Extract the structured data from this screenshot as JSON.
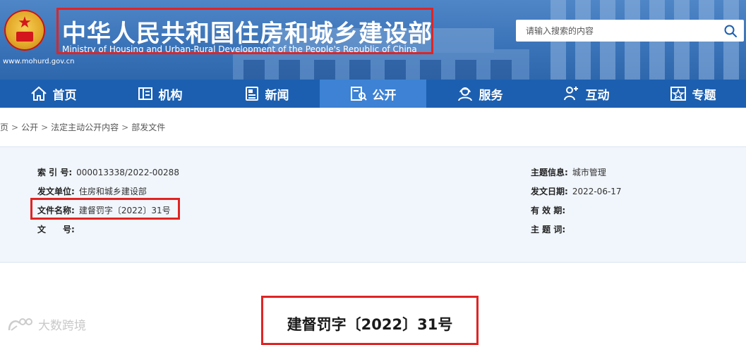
{
  "header": {
    "title_cn": "中华人民共和国住房和城乡建设部",
    "title_en": "Ministry of Housing and Urban-Rural Development of the People's Republic of China",
    "site_url": "www.mohurd.gov.cn",
    "search_placeholder": "请输入搜索的内容"
  },
  "nav": {
    "items": [
      {
        "label": "首页",
        "icon": "home-icon"
      },
      {
        "label": "机构",
        "icon": "org-icon"
      },
      {
        "label": "新闻",
        "icon": "news-icon"
      },
      {
        "label": "公开",
        "icon": "disclosure-icon",
        "active": true
      },
      {
        "label": "服务",
        "icon": "service-icon"
      },
      {
        "label": "互动",
        "icon": "interact-icon"
      },
      {
        "label": "专题",
        "icon": "topic-icon"
      }
    ]
  },
  "breadcrumb": [
    "页",
    "公开",
    "法定主动公开内容",
    "部发文件"
  ],
  "info": {
    "index_no_label": "索 引 号:",
    "index_no": "000013338/2022-00288",
    "issuer_label": "发文单位:",
    "issuer": "住房和城乡建设部",
    "doc_name_label": "文件名称:",
    "doc_name": "建督罚字〔2022〕31号",
    "doc_no_label": "文　　号:",
    "doc_no": "",
    "topic_label": "主题信息:",
    "topic": "城市管理",
    "date_label": "发文日期:",
    "date": "2022-06-17",
    "validity_label": "有 效 期:",
    "validity": "",
    "keywords_label": "主 题 词:",
    "keywords": ""
  },
  "doc_title": "建督罚字〔2022〕31号",
  "watermark": "大数跨境",
  "colors": {
    "header_blue": "#3b74b9",
    "nav_blue": "#1c5fb0",
    "nav_active": "#3d82d4",
    "highlight_red": "#e02424",
    "info_bg": "#f1f6fc"
  }
}
